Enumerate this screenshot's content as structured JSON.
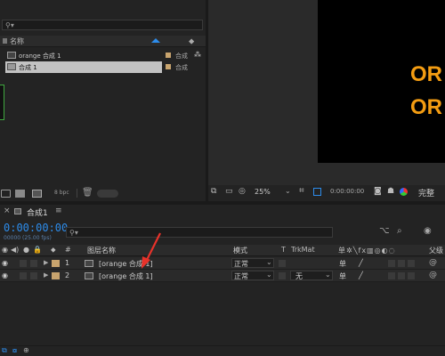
{
  "project": {
    "search_placeholder": "",
    "column_name": "名称",
    "items": [
      {
        "name": "orange 合成 1",
        "type": "合成"
      },
      {
        "name": "合成 1",
        "type": "合成"
      }
    ],
    "bpc": "8 bpc"
  },
  "viewer": {
    "overlay_lines": [
      "OR",
      "OR"
    ],
    "zoom": "25%",
    "timecode": "0:00:00:00",
    "quality": "完整"
  },
  "timeline": {
    "tab_label": "合成1",
    "current_time": "0:00:00:00",
    "frame_info": "00000 (25.00 fps)",
    "search_placeholder": "",
    "columns": {
      "hash": "#",
      "layer_name": "图层名称",
      "mode": "模式",
      "t": "T",
      "trkmat": "TrkMat",
      "parent": "父级"
    },
    "layers": [
      {
        "index": "1",
        "name": "[orange 合成 1]",
        "mode": "正常",
        "trkmat": ""
      },
      {
        "index": "2",
        "name": "[orange 合成 1]",
        "mode": "正常",
        "trkmat": "无"
      }
    ]
  },
  "colors": {
    "accent_blue": "#2d8ceb",
    "overlay_orange": "#f39c12",
    "label_tan": "#c8a46e",
    "annotation_red": "#e8322a"
  }
}
